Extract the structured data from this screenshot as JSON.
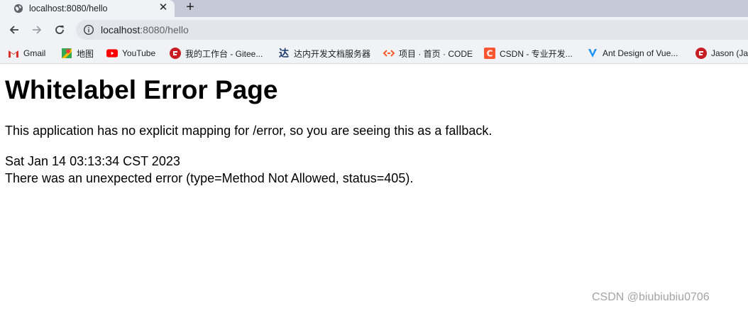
{
  "tab": {
    "title": "localhost:8080/hello",
    "close_glyph": "✕",
    "new_tab_glyph": "+"
  },
  "toolbar": {
    "back_icon": "arrow-left-icon",
    "forward_icon": "arrow-right-icon",
    "reload_icon": "reload-icon",
    "url_host": "localhost",
    "url_rest": ":8080/hello"
  },
  "bookmarks": [
    {
      "label": "Gmail",
      "icon": "gmail-icon"
    },
    {
      "label": "地图",
      "icon": "maps-icon"
    },
    {
      "label": "YouTube",
      "icon": "youtube-icon"
    },
    {
      "label": "我的工作台 - Gitee...",
      "icon": "gitee-icon"
    },
    {
      "label": "达内开发文档服务器",
      "icon": "tarena-icon"
    },
    {
      "label": "项目 · 首页 · CODE",
      "icon": "code-icon"
    },
    {
      "label": "CSDN - 专业开发...",
      "icon": "csdn-icon"
    },
    {
      "label": "Ant Design of Vue...",
      "icon": "antdv-icon"
    },
    {
      "label": "Jason (Ja",
      "icon": "gitee-icon"
    }
  ],
  "page": {
    "heading": "Whitelabel Error Page",
    "message": "This application has no explicit mapping for /error, so you are seeing this as a fallback.",
    "timestamp": "Sat Jan 14 03:13:34 CST 2023",
    "error": "There was an unexpected error (type=Method Not Allowed, status=405)."
  },
  "watermark": "CSDN @biubiubiu0706",
  "colors": {
    "tabstrip": "#c6c9d8",
    "toolbar": "#f1f2f6",
    "omnibox": "#e3e5ec"
  }
}
